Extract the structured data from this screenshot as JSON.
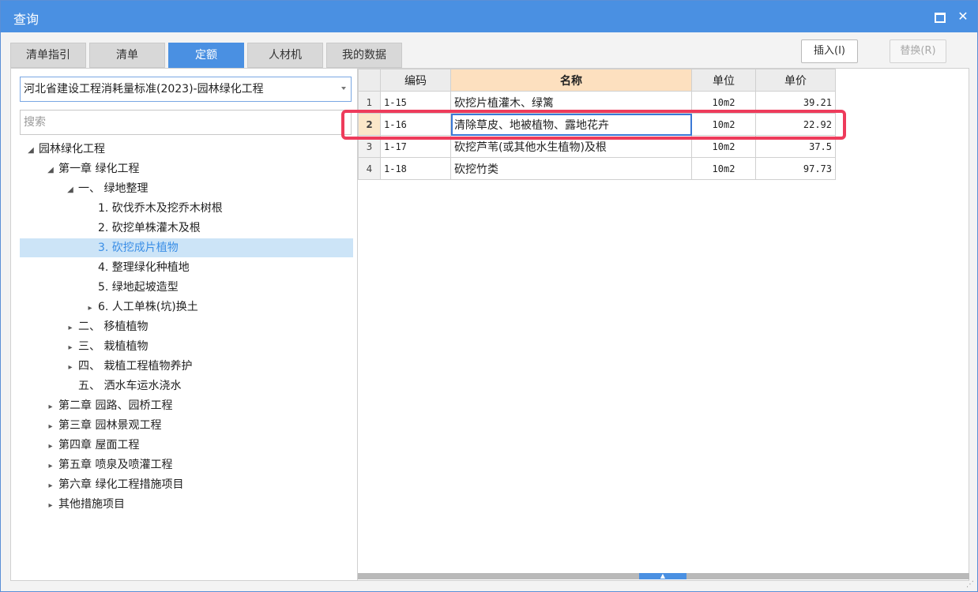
{
  "window": {
    "title": "查询"
  },
  "tabs": [
    {
      "label": "清单指引",
      "active": false
    },
    {
      "label": "清单",
      "active": false
    },
    {
      "label": "定额",
      "active": true
    },
    {
      "label": "人材机",
      "active": false
    },
    {
      "label": "我的数据",
      "active": false
    }
  ],
  "buttons": {
    "insert": "插入(I)",
    "replace": "替换(R)"
  },
  "library_select": {
    "value": "河北省建设工程消耗量标准(2023)-园林绿化工程"
  },
  "search": {
    "placeholder": "搜索"
  },
  "tree": [
    {
      "label": "园林绿化工程",
      "toggle": "◢",
      "selected": false
    },
    {
      "label": "第一章 绿化工程",
      "toggle": "◢",
      "selected": false
    },
    {
      "label": "一、  绿地整理",
      "toggle": "◢",
      "selected": false
    },
    {
      "label": "1. 砍伐乔木及挖乔木树根",
      "toggle": "",
      "selected": false
    },
    {
      "label": "2. 砍挖单株灌木及根",
      "toggle": "",
      "selected": false
    },
    {
      "label": "3. 砍挖成片植物",
      "toggle": "",
      "selected": true
    },
    {
      "label": "4. 整理绿化种植地",
      "toggle": "",
      "selected": false
    },
    {
      "label": "5. 绿地起坡造型",
      "toggle": "",
      "selected": false
    },
    {
      "label": "6. 人工单株(坑)换土",
      "toggle": "▸",
      "selected": false
    },
    {
      "label": "二、  移植植物",
      "toggle": "▸",
      "selected": false
    },
    {
      "label": "三、  栽植植物",
      "toggle": "▸",
      "selected": false
    },
    {
      "label": "四、  栽植工程植物养护",
      "toggle": "▸",
      "selected": false
    },
    {
      "label": "五、  洒水车运水浇水",
      "toggle": "",
      "selected": false
    },
    {
      "label": "第二章 园路、园桥工程",
      "toggle": "▸",
      "selected": false
    },
    {
      "label": "第三章 园林景观工程",
      "toggle": "▸",
      "selected": false
    },
    {
      "label": "第四章 屋面工程",
      "toggle": "▸",
      "selected": false
    },
    {
      "label": "第五章 喷泉及喷灌工程",
      "toggle": "▸",
      "selected": false
    },
    {
      "label": "第六章 绿化工程措施项目",
      "toggle": "▸",
      "selected": false
    },
    {
      "label": "其他措施项目",
      "toggle": "▸",
      "selected": false
    }
  ],
  "table": {
    "headers": {
      "code": "编码",
      "name": "名称",
      "unit": "单位",
      "price": "单价"
    },
    "rows": [
      {
        "idx": "1",
        "code": "1-15",
        "name": "砍挖片植灌木、绿篱",
        "unit": "10m2",
        "price": "39.21"
      },
      {
        "idx": "2",
        "code": "1-16",
        "name": "清除草皮、地被植物、露地花卉",
        "unit": "10m2",
        "price": "22.92"
      },
      {
        "idx": "3",
        "code": "1-17",
        "name": "砍挖芦苇(或其他水生植物)及根",
        "unit": "10m2",
        "price": "37.5"
      },
      {
        "idx": "4",
        "code": "1-18",
        "name": "砍挖竹类",
        "unit": "10m2",
        "price": "97.73"
      }
    ]
  }
}
